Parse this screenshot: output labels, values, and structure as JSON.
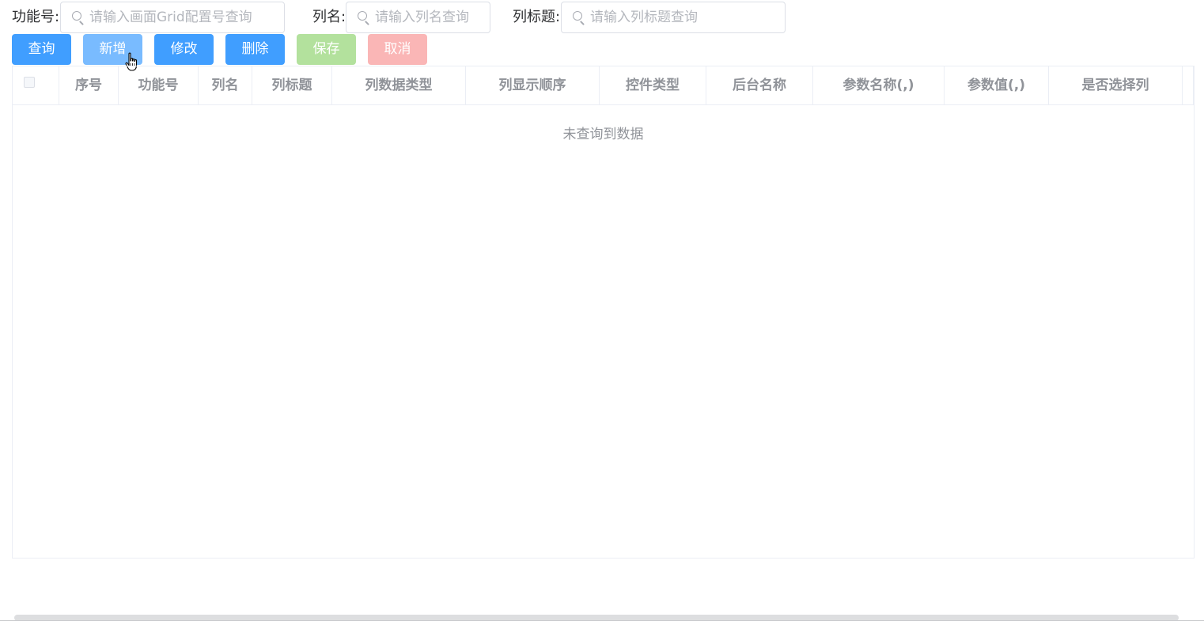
{
  "search": {
    "function_no": {
      "label": "功能号:",
      "value": "",
      "placeholder": "请输入画面Grid配置号查询"
    },
    "column_name": {
      "label": "列名:",
      "value": "",
      "placeholder": "请输入列名查询"
    },
    "column_title": {
      "label": "列标题:",
      "value": "",
      "placeholder": "请输入列标题查询"
    }
  },
  "toolbar": {
    "query_label": "查询",
    "add_label": "新增",
    "edit_label": "修改",
    "delete_label": "删除",
    "save_label": "保存",
    "cancel_label": "取消"
  },
  "table": {
    "columns": [
      "",
      "序号",
      "功能号",
      "列名",
      "列标题",
      "列数据类型",
      "列显示顺序",
      "控件类型",
      "后台名称",
      "参数名称(,)",
      "参数值(,)",
      "是否选择列"
    ],
    "rows": [],
    "empty_text": "未查询到数据"
  },
  "colors": {
    "primary": "#409eff",
    "primary_hover": "#79bbff",
    "success_disabled": "#b3e19d",
    "danger_disabled": "#fab6b6",
    "header_text": "#909399",
    "border": "#ebeef5"
  },
  "icons": {
    "search": "search-icon",
    "cursor": "hand-pointer-icon"
  }
}
